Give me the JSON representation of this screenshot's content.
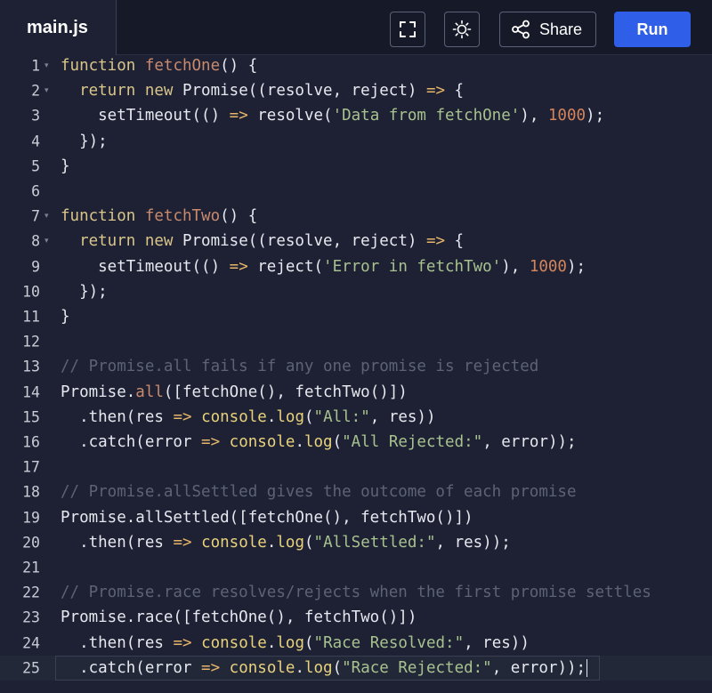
{
  "header": {
    "tab_label": "main.js",
    "share_label": "Share",
    "run_label": "Run"
  },
  "colors": {
    "keyword": "#d9c58a",
    "funcname": "#c98a6e",
    "string": "#a8c28f",
    "number": "#d4855c",
    "comment": "#5d6275",
    "arrow": "#e6b56a",
    "console": "#e8d27d",
    "plain": "#e6e8ef",
    "run": "#2f5ee8"
  },
  "editor": {
    "active_line": 25,
    "lines": [
      {
        "n": "1",
        "fold": true,
        "tokens": [
          [
            "kw",
            "function"
          ],
          [
            "p",
            " "
          ],
          [
            "fn",
            "fetchOne"
          ],
          [
            "p",
            "() {"
          ]
        ]
      },
      {
        "n": "2",
        "fold": true,
        "tokens": [
          [
            "p",
            "  "
          ],
          [
            "kw",
            "return"
          ],
          [
            "p",
            " "
          ],
          [
            "kw",
            "new"
          ],
          [
            "p",
            " Promise((resolve, reject) "
          ],
          [
            "ar",
            "=>"
          ],
          [
            "p",
            " {"
          ]
        ]
      },
      {
        "n": "3",
        "fold": false,
        "tokens": [
          [
            "p",
            "    setTimeout(() "
          ],
          [
            "ar",
            "=>"
          ],
          [
            "p",
            " resolve("
          ],
          [
            "st",
            "'Data from fetchOne'"
          ],
          [
            "p",
            "), "
          ],
          [
            "nu",
            "1000"
          ],
          [
            "p",
            ");"
          ]
        ]
      },
      {
        "n": "4",
        "fold": false,
        "tokens": [
          [
            "p",
            "  });"
          ]
        ]
      },
      {
        "n": "5",
        "fold": false,
        "tokens": [
          [
            "p",
            "}"
          ]
        ]
      },
      {
        "n": "6",
        "fold": false,
        "tokens": []
      },
      {
        "n": "7",
        "fold": true,
        "tokens": [
          [
            "kw",
            "function"
          ],
          [
            "p",
            " "
          ],
          [
            "fn",
            "fetchTwo"
          ],
          [
            "p",
            "() {"
          ]
        ]
      },
      {
        "n": "8",
        "fold": true,
        "tokens": [
          [
            "p",
            "  "
          ],
          [
            "kw",
            "return"
          ],
          [
            "p",
            " "
          ],
          [
            "kw",
            "new"
          ],
          [
            "p",
            " Promise((resolve, reject) "
          ],
          [
            "ar",
            "=>"
          ],
          [
            "p",
            " {"
          ]
        ]
      },
      {
        "n": "9",
        "fold": false,
        "tokens": [
          [
            "p",
            "    setTimeout(() "
          ],
          [
            "ar",
            "=>"
          ],
          [
            "p",
            " reject("
          ],
          [
            "st",
            "'Error in fetchTwo'"
          ],
          [
            "p",
            "), "
          ],
          [
            "nu",
            "1000"
          ],
          [
            "p",
            ");"
          ]
        ]
      },
      {
        "n": "10",
        "fold": false,
        "tokens": [
          [
            "p",
            "  });"
          ]
        ]
      },
      {
        "n": "11",
        "fold": false,
        "tokens": [
          [
            "p",
            "}"
          ]
        ]
      },
      {
        "n": "12",
        "fold": false,
        "tokens": []
      },
      {
        "n": "13",
        "fold": false,
        "tokens": [
          [
            "cm",
            "// Promise.all fails if any one promise is rejected"
          ]
        ]
      },
      {
        "n": "14",
        "fold": false,
        "tokens": [
          [
            "p",
            "Promise."
          ],
          [
            "fn",
            "all"
          ],
          [
            "p",
            "([fetchOne(), fetchTwo()])"
          ]
        ]
      },
      {
        "n": "15",
        "fold": false,
        "tokens": [
          [
            "p",
            "  .then(res "
          ],
          [
            "ar",
            "=>"
          ],
          [
            "p",
            " "
          ],
          [
            "co",
            "console"
          ],
          [
            "p",
            "."
          ],
          [
            "co",
            "log"
          ],
          [
            "p",
            "("
          ],
          [
            "st",
            "\"All:\""
          ],
          [
            "p",
            ", res))"
          ]
        ]
      },
      {
        "n": "16",
        "fold": false,
        "tokens": [
          [
            "p",
            "  .catch(error "
          ],
          [
            "ar",
            "=>"
          ],
          [
            "p",
            " "
          ],
          [
            "co",
            "console"
          ],
          [
            "p",
            "."
          ],
          [
            "co",
            "log"
          ],
          [
            "p",
            "("
          ],
          [
            "st",
            "\"All Rejected:\""
          ],
          [
            "p",
            ", error));"
          ]
        ]
      },
      {
        "n": "17",
        "fold": false,
        "tokens": []
      },
      {
        "n": "18",
        "fold": false,
        "tokens": [
          [
            "cm",
            "// Promise.allSettled gives the outcome of each promise"
          ]
        ]
      },
      {
        "n": "19",
        "fold": false,
        "tokens": [
          [
            "p",
            "Promise.allSettled([fetchOne(), fetchTwo()])"
          ]
        ]
      },
      {
        "n": "20",
        "fold": false,
        "tokens": [
          [
            "p",
            "  .then(res "
          ],
          [
            "ar",
            "=>"
          ],
          [
            "p",
            " "
          ],
          [
            "co",
            "console"
          ],
          [
            "p",
            "."
          ],
          [
            "co",
            "log"
          ],
          [
            "p",
            "("
          ],
          [
            "st",
            "\"AllSettled:\""
          ],
          [
            "p",
            ", res));"
          ]
        ]
      },
      {
        "n": "21",
        "fold": false,
        "tokens": []
      },
      {
        "n": "22",
        "fold": false,
        "tokens": [
          [
            "cm",
            "// Promise.race resolves/rejects when the first promise settles"
          ]
        ]
      },
      {
        "n": "23",
        "fold": false,
        "tokens": [
          [
            "p",
            "Promise.race([fetchOne(), fetchTwo()])"
          ]
        ]
      },
      {
        "n": "24",
        "fold": false,
        "tokens": [
          [
            "p",
            "  .then(res "
          ],
          [
            "ar",
            "=>"
          ],
          [
            "p",
            " "
          ],
          [
            "co",
            "console"
          ],
          [
            "p",
            "."
          ],
          [
            "co",
            "log"
          ],
          [
            "p",
            "("
          ],
          [
            "st",
            "\"Race Resolved:\""
          ],
          [
            "p",
            ", res))"
          ]
        ]
      },
      {
        "n": "25",
        "fold": false,
        "tokens": [
          [
            "p",
            "  .catch(error "
          ],
          [
            "ar",
            "=>"
          ],
          [
            "p",
            " "
          ],
          [
            "co",
            "console"
          ],
          [
            "p",
            "."
          ],
          [
            "co",
            "log"
          ],
          [
            "p",
            "("
          ],
          [
            "st",
            "\"Race Rejected:\""
          ],
          [
            "p",
            ", error));"
          ]
        ]
      }
    ]
  }
}
